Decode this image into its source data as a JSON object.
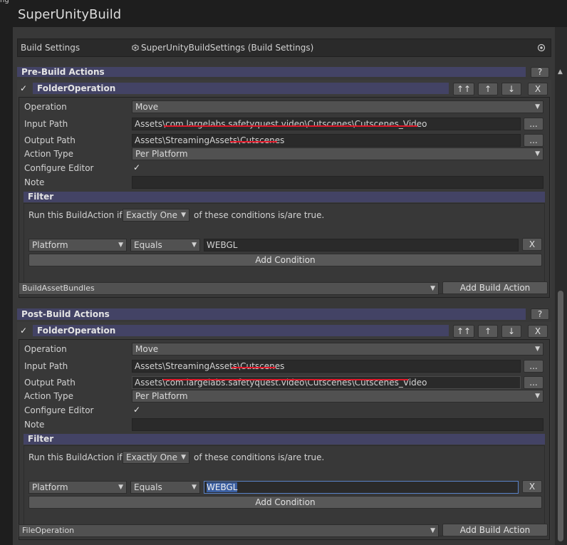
{
  "window": {
    "corner_text": "ng",
    "title": "SuperUnityBuild"
  },
  "build_settings": {
    "label": "Build Settings",
    "value": "SuperUnityBuildSettings (Build Settings)",
    "asset_icon": "scriptable-object-icon",
    "picker_icon": "object-picker-icon"
  },
  "pre": {
    "title": "Pre-Build Actions",
    "help": "?",
    "action": {
      "enabled_check": "✓",
      "name": "FolderOperation",
      "move_top": "↑↑",
      "move_up": "↑",
      "move_down": "↓",
      "remove": "X",
      "operation_label": "Operation",
      "operation_value": "Move",
      "input_label": "Input Path",
      "input_value": "Assets\\com.largelabs.safetyquest.video\\Cutscenes\\Cutscenes_Video",
      "output_label": "Output Path",
      "output_value": "Assets\\StreamingAssets\\Cutscenes",
      "browse": "...",
      "type_label": "Action Type",
      "type_value": "Per Platform",
      "configure_label": "Configure Editor",
      "configure_check": "✓",
      "note_label": "Note",
      "note_value": "",
      "filter_title": "Filter",
      "filter_prefix": "Run this BuildAction if",
      "filter_mode": "Exactly One",
      "filter_suffix": "of these conditions is/are true.",
      "cond_type": "Platform",
      "cond_comparison": "Equals",
      "cond_value": "WEBGL",
      "cond_remove": "X",
      "add_condition": "Add Condition"
    },
    "add_select": "BuildAssetBundles",
    "add_button": "Add Build Action"
  },
  "post": {
    "title": "Post-Build Actions",
    "help": "?",
    "action": {
      "enabled_check": "✓",
      "name": "FolderOperation",
      "move_top": "↑↑",
      "move_up": "↑",
      "move_down": "↓",
      "remove": "X",
      "operation_label": "Operation",
      "operation_value": "Move",
      "input_label": "Input Path",
      "input_value": "Assets\\StreamingAssets\\Cutscenes",
      "output_label": "Output Path",
      "output_value": "Assets\\com.largelabs.safetyquest.video\\Cutscenes\\Cutscenes_Video",
      "browse": "...",
      "type_label": "Action Type",
      "type_value": "Per Platform",
      "configure_label": "Configure Editor",
      "configure_check": "✓",
      "note_label": "Note",
      "note_value": "",
      "filter_title": "Filter",
      "filter_prefix": "Run this BuildAction if",
      "filter_mode": "Exactly One",
      "filter_suffix": "of these conditions is/are true.",
      "cond_type": "Platform",
      "cond_comparison": "Equals",
      "cond_value": "WEBGL",
      "cond_remove": "X",
      "add_condition": "Add Condition"
    },
    "add_select": "FileOperation",
    "add_button": "Add Build Action"
  },
  "colors": {
    "header": "#434365",
    "background": "#383838",
    "field": "#2a2a2a",
    "annotation": "#e0192a"
  }
}
